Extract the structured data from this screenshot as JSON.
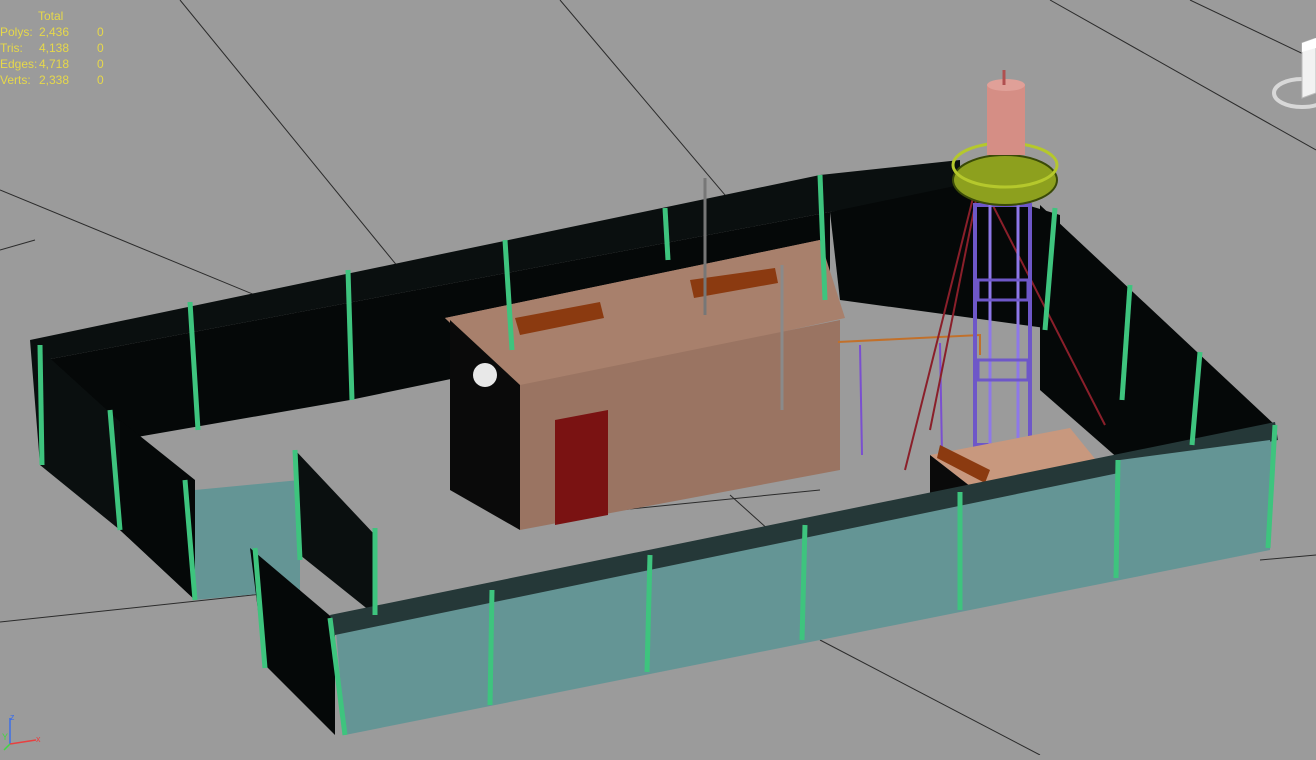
{
  "viewport": {
    "background": "#9b9b9b",
    "grid_color": "#2b2b2b",
    "stats": {
      "header": "Total",
      "rows": [
        {
          "label": "Polys:",
          "total": "2,436",
          "selected": "0"
        },
        {
          "label": "Tris:",
          "total": "4,138",
          "selected": "0"
        },
        {
          "label": "Edges:",
          "total": "4,718",
          "selected": "0"
        },
        {
          "label": "Verts:",
          "total": "2,338",
          "selected": "0"
        }
      ],
      "color": "#e6d84a"
    },
    "axis_labels": {
      "x": "x",
      "y": "Y",
      "z": "z"
    },
    "colors": {
      "wall_outer": "#649595",
      "wall_dark": "#0a0f0f",
      "post": "#3ec47e",
      "building": "#a8806c",
      "building_front": "#9a7462",
      "door": "#7a1212",
      "bench": "#8b3a10",
      "tower_frame": "#6e57c8",
      "tower_deck": "#8da01e",
      "tank": "#d58e85"
    }
  }
}
